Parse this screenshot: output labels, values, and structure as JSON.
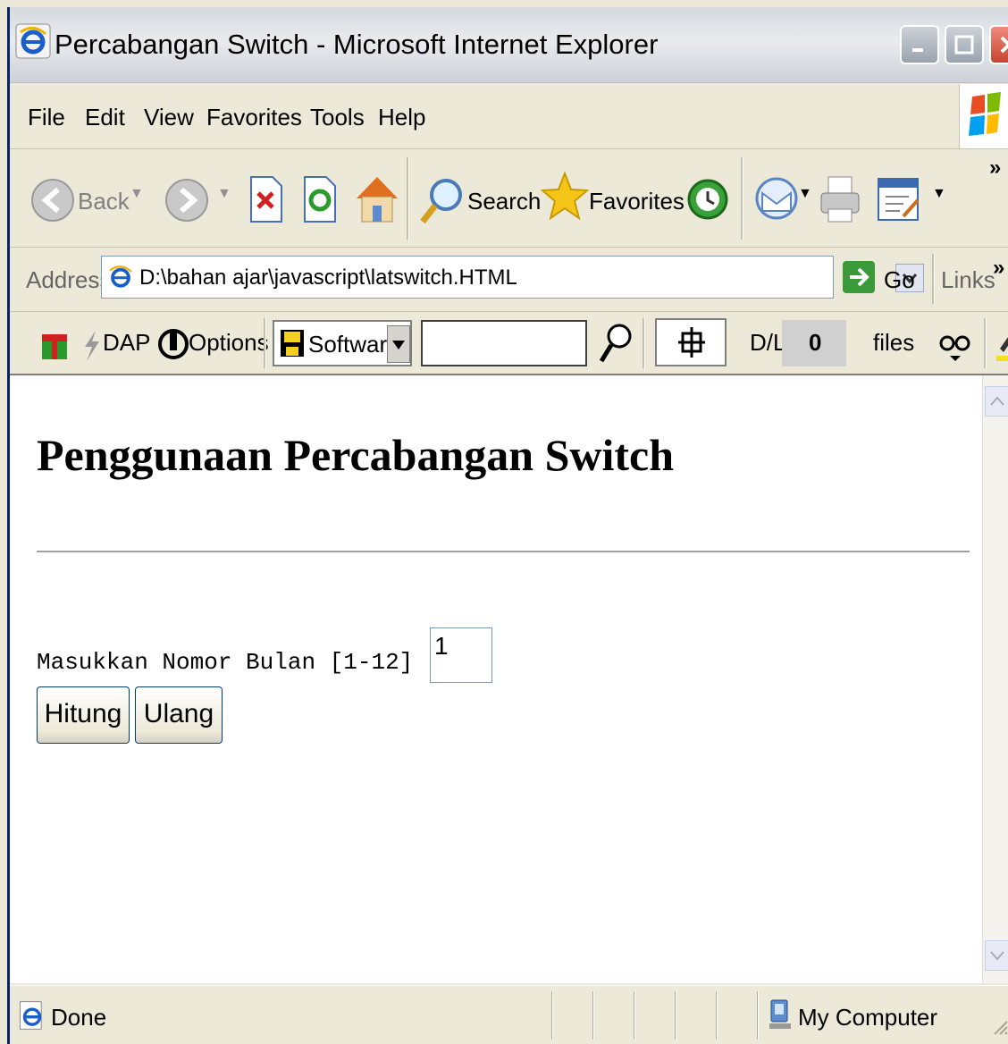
{
  "window": {
    "title": "Percabangan Switch - Microsoft Internet Explorer"
  },
  "menu": [
    "File",
    "Edit",
    "View",
    "Favorites",
    "Tools",
    "Help"
  ],
  "toolbar": {
    "back_label": "Back",
    "search_label": "Search",
    "favorites_label": "Favorites",
    "more": "»"
  },
  "address": {
    "label": "Address",
    "value": "D:\\bahan ajar\\javascript\\latswitch.HTML",
    "go_label": "Go",
    "links_label": "Links",
    "more": "»"
  },
  "custom_toolbar": {
    "dap_label": "DAP",
    "options_label": "Options",
    "software_label": "Software",
    "dl_label": "D/L",
    "dl_count": "0",
    "files_label": "files"
  },
  "page": {
    "heading": "Penggunaan Percabangan Switch",
    "prompt": "Masukkan Nomor Bulan [1-12] :",
    "input_value": "1",
    "hitung_label": "Hitung",
    "ulang_label": "Ulang"
  },
  "status": {
    "text": "Done",
    "zone": "My Computer"
  },
  "colors": {
    "title_close": "#c8452e",
    "chrome": "#ece9d8",
    "button_border": "#003c74"
  }
}
